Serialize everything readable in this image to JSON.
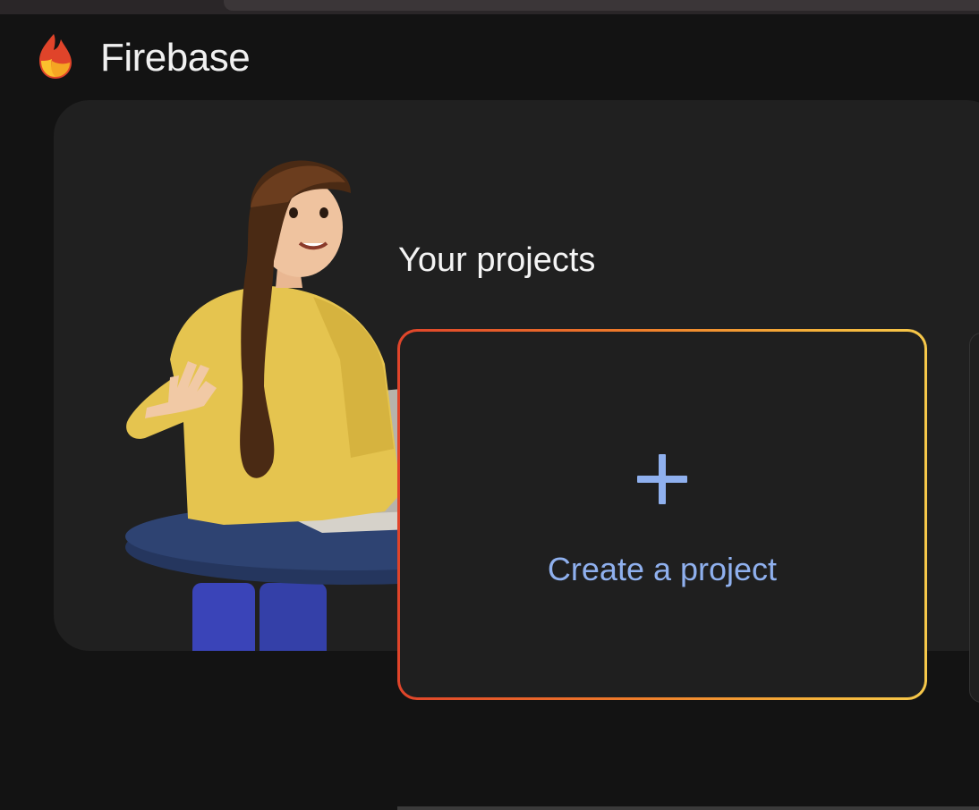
{
  "header": {
    "brand": "Firebase",
    "logo_icon": "firebase-flame-icon"
  },
  "main": {
    "section_title": "Your projects",
    "create_card": {
      "icon": "plus-icon",
      "label": "Create a project"
    }
  },
  "colors": {
    "background": "#131313",
    "hero_panel": "#202020",
    "card_background": "#1f1f1f",
    "create_label": "#8fb0ee",
    "plus": "#8fb0ee",
    "card_border_gradient": [
      "#e0442a",
      "#ef7d2a",
      "#f5b23a",
      "#f6c84a"
    ],
    "logo": [
      "#e0442a",
      "#f5a623",
      "#fbc02d"
    ]
  }
}
